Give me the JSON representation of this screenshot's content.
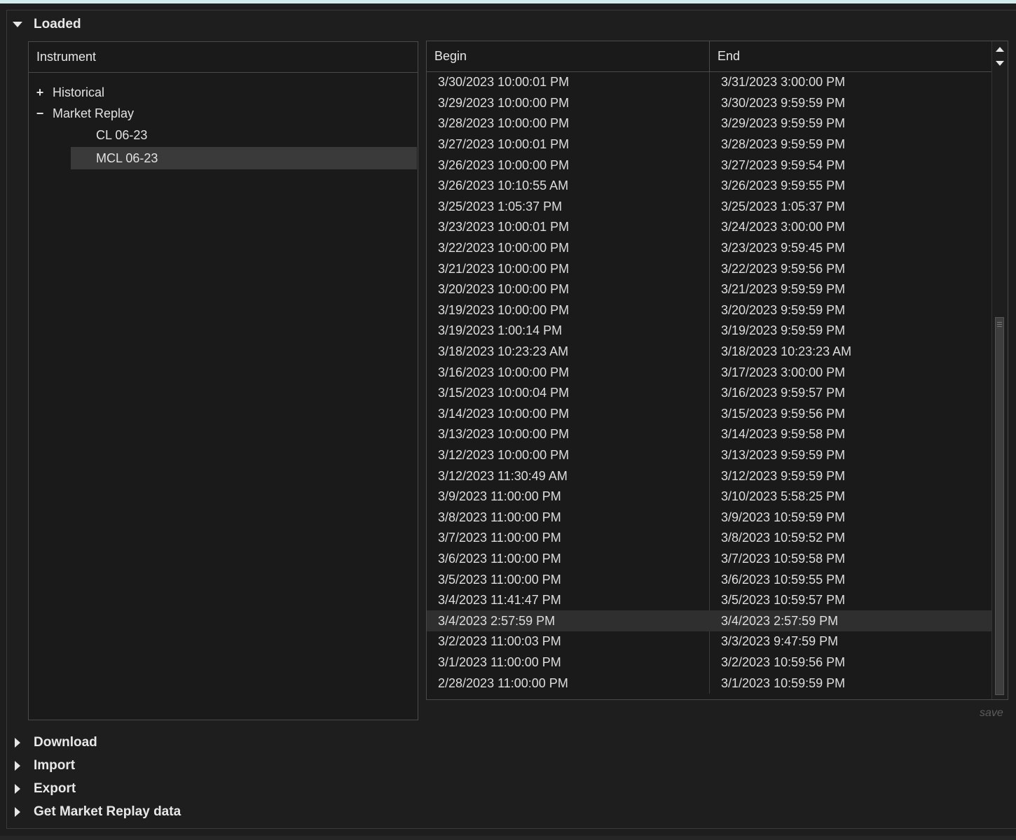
{
  "sections": {
    "loaded": "Loaded",
    "download": "Download",
    "import": "Import",
    "export": "Export",
    "get_market_replay": "Get Market Replay data"
  },
  "instrument_panel": {
    "header": "Instrument",
    "tree": {
      "historical": {
        "toggle": "+",
        "label": "Historical"
      },
      "market_replay": {
        "toggle": "−",
        "label": "Market Replay"
      },
      "children": [
        "CL 06-23",
        "MCL 06-23"
      ],
      "selected_child": "MCL 06-23"
    }
  },
  "table": {
    "columns": {
      "begin": "Begin",
      "end": "End"
    },
    "rows": [
      {
        "begin": "3/30/2023 10:00:01 PM",
        "end": "3/31/2023 3:00:00 PM"
      },
      {
        "begin": "3/29/2023 10:00:00 PM",
        "end": "3/30/2023 9:59:59 PM"
      },
      {
        "begin": "3/28/2023 10:00:00 PM",
        "end": "3/29/2023 9:59:59 PM"
      },
      {
        "begin": "3/27/2023 10:00:01 PM",
        "end": "3/28/2023 9:59:59 PM"
      },
      {
        "begin": "3/26/2023 10:00:00 PM",
        "end": "3/27/2023 9:59:54 PM"
      },
      {
        "begin": "3/26/2023 10:10:55 AM",
        "end": "3/26/2023 9:59:55 PM"
      },
      {
        "begin": "3/25/2023 1:05:37 PM",
        "end": "3/25/2023 1:05:37 PM"
      },
      {
        "begin": "3/23/2023 10:00:01 PM",
        "end": "3/24/2023 3:00:00 PM"
      },
      {
        "begin": "3/22/2023 10:00:00 PM",
        "end": "3/23/2023 9:59:45 PM"
      },
      {
        "begin": "3/21/2023 10:00:00 PM",
        "end": "3/22/2023 9:59:56 PM"
      },
      {
        "begin": "3/20/2023 10:00:00 PM",
        "end": "3/21/2023 9:59:59 PM"
      },
      {
        "begin": "3/19/2023 10:00:00 PM",
        "end": "3/20/2023 9:59:59 PM"
      },
      {
        "begin": "3/19/2023 1:00:14 PM",
        "end": "3/19/2023 9:59:59 PM"
      },
      {
        "begin": "3/18/2023 10:23:23 AM",
        "end": "3/18/2023 10:23:23 AM"
      },
      {
        "begin": "3/16/2023 10:00:00 PM",
        "end": "3/17/2023 3:00:00 PM"
      },
      {
        "begin": "3/15/2023 10:00:04 PM",
        "end": "3/16/2023 9:59:57 PM"
      },
      {
        "begin": "3/14/2023 10:00:00 PM",
        "end": "3/15/2023 9:59:56 PM"
      },
      {
        "begin": "3/13/2023 10:00:00 PM",
        "end": "3/14/2023 9:59:58 PM"
      },
      {
        "begin": "3/12/2023 10:00:00 PM",
        "end": "3/13/2023 9:59:59 PM"
      },
      {
        "begin": "3/12/2023 11:30:49 AM",
        "end": "3/12/2023 9:59:59 PM"
      },
      {
        "begin": "3/9/2023 11:00:00 PM",
        "end": "3/10/2023 5:58:25 PM"
      },
      {
        "begin": "3/8/2023 11:00:00 PM",
        "end": "3/9/2023 10:59:59 PM"
      },
      {
        "begin": "3/7/2023 11:00:00 PM",
        "end": "3/8/2023 10:59:52 PM"
      },
      {
        "begin": "3/6/2023 11:00:00 PM",
        "end": "3/7/2023 10:59:58 PM"
      },
      {
        "begin": "3/5/2023 11:00:00 PM",
        "end": "3/6/2023 10:59:55 PM"
      },
      {
        "begin": "3/4/2023 11:41:47 PM",
        "end": "3/5/2023 10:59:57 PM"
      },
      {
        "begin": "3/4/2023 2:57:59 PM",
        "end": "3/4/2023 2:57:59 PM"
      },
      {
        "begin": "3/2/2023 11:00:03 PM",
        "end": "3/3/2023 9:47:59 PM"
      },
      {
        "begin": "3/1/2023 11:00:00 PM",
        "end": "3/2/2023 10:59:56 PM"
      },
      {
        "begin": "2/28/2023 11:00:00 PM",
        "end": "3/1/2023 10:59:59 PM"
      }
    ],
    "selected_row": 26
  },
  "save_link": "save"
}
